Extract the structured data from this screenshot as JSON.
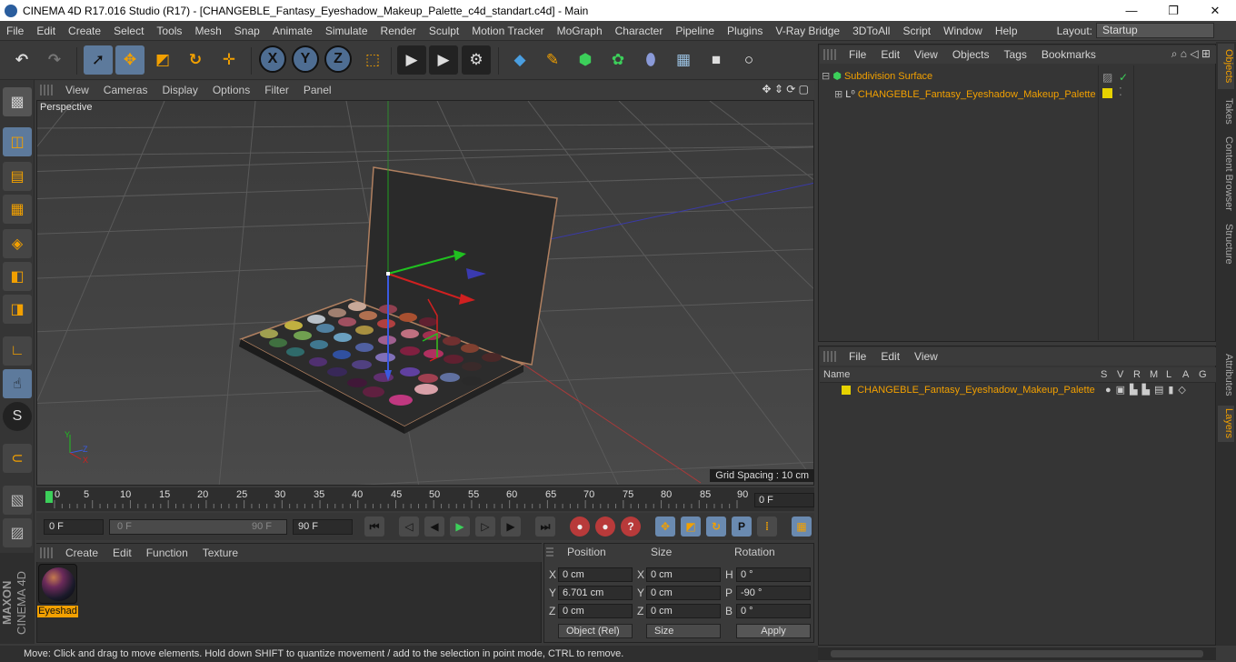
{
  "window": {
    "title": "CINEMA 4D R17.016 Studio (R17) - [CHANGEBLE_Fantasy_Eyeshadow_Makeup_Palette_c4d_standart.c4d] - Main",
    "min_glyph": "—",
    "max_glyph": "❐",
    "close_glyph": "✕"
  },
  "menubar": {
    "items": [
      "File",
      "Edit",
      "Create",
      "Select",
      "Tools",
      "Mesh",
      "Snap",
      "Animate",
      "Simulate",
      "Render",
      "Sculpt",
      "Motion Tracker",
      "MoGraph",
      "Character",
      "Pipeline",
      "Plugins",
      "V-Ray Bridge",
      "3DToAll",
      "Script",
      "Window",
      "Help"
    ],
    "layout_label": "Layout:",
    "layout_value": "Startup"
  },
  "toolbar": {
    "axis_x": "X",
    "axis_y": "Y",
    "axis_z": "Z"
  },
  "viewport": {
    "menu": [
      "View",
      "Cameras",
      "Display",
      "Options",
      "Filter",
      "Panel"
    ],
    "label": "Perspective",
    "grid_spacing": "Grid Spacing : 10 cm"
  },
  "timeline": {
    "ticks": [
      "0",
      "5",
      "10",
      "15",
      "20",
      "25",
      "30",
      "35",
      "40",
      "45",
      "50",
      "55",
      "60",
      "65",
      "70",
      "75",
      "80",
      "85",
      "90"
    ],
    "frame_end_box": "0 F",
    "start_field": "0 F",
    "range_start": "0 F",
    "range_end": "90 F",
    "end_field": "90 F"
  },
  "material_manager": {
    "menu": [
      "Create",
      "Edit",
      "Function",
      "Texture"
    ],
    "material_name": "Eyeshad"
  },
  "coordinates": {
    "headers": [
      "Position",
      "Size",
      "Rotation"
    ],
    "rows": [
      {
        "pl": "X",
        "pv": "0 cm",
        "sl": "X",
        "sv": "0 cm",
        "rl": "H",
        "rv": "0 °"
      },
      {
        "pl": "Y",
        "pv": "6.701 cm",
        "sl": "Y",
        "sv": "0 cm",
        "rl": "P",
        "rv": "-90 °"
      },
      {
        "pl": "Z",
        "pv": "0 cm",
        "sl": "Z",
        "sv": "0 cm",
        "rl": "B",
        "rv": "0 °"
      }
    ],
    "mode_dropdown": "Object (Rel)",
    "size_dropdown": "Size",
    "apply": "Apply"
  },
  "objects_panel": {
    "menu": [
      "File",
      "Edit",
      "View",
      "Objects",
      "Tags",
      "Bookmarks"
    ],
    "items": [
      {
        "name": "Subdivision Surface"
      },
      {
        "name": "CHANGEBLE_Fantasy_Eyeshadow_Makeup_Palette"
      }
    ]
  },
  "layers_panel": {
    "menu": [
      "File",
      "Edit",
      "View"
    ],
    "col_name": "Name",
    "flags": [
      "S",
      "V",
      "R",
      "M",
      "L",
      "A",
      "G"
    ],
    "row_name": "CHANGEBLE_Fantasy_Eyeshadow_Makeup_Palette"
  },
  "right_tabs": [
    "Objects",
    "Takes",
    "Content Browser",
    "Structure",
    "Attributes",
    "Layers"
  ],
  "status": "Move: Click and drag to move elements. Hold down SHIFT to quantize movement / add to the selection in point mode, CTRL to remove.",
  "brand": {
    "line1": "MAXON",
    "line2": "CINEMA 4D"
  },
  "colors": {
    "accent": "#f2a000",
    "selected": "#5d7a9c",
    "layer_color": "#e6d200"
  }
}
